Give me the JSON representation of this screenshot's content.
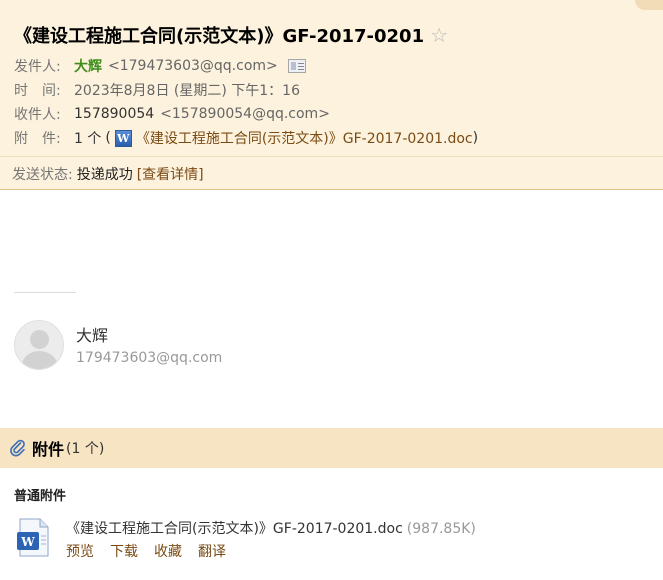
{
  "email": {
    "subject": "《建设工程施工合同(示范文本)》GF-2017-0201",
    "star_icon": "☆",
    "from": {
      "label": "发件人:",
      "name": "大辉",
      "address": "<179473603@qq.com>"
    },
    "time": {
      "label": "时　间:",
      "value": "2023年8月8日 (星期二) 下午1：16"
    },
    "to": {
      "label": "收件人:",
      "name": "157890054",
      "address": "<157890054@qq.com>"
    },
    "attachment_line": {
      "label": "附　件:",
      "count": "1 个",
      "open_paren": "(",
      "icon_letter": "W",
      "file": "《建设工程施工合同(示范文本)》GF-2017-0201.doc",
      "close_paren": ")"
    },
    "status": {
      "label": "发送状态:",
      "value": "投递成功",
      "link": "[查看详情]"
    }
  },
  "signature": {
    "name": "大辉",
    "email": "179473603@qq.com"
  },
  "attachments": {
    "title": "附件",
    "count": "(1 个)",
    "group": "普通附件",
    "items": [
      {
        "filename": "《建设工程施工合同(示范文本)》GF-2017-0201.doc",
        "size": "(987.85K)",
        "actions": [
          "预览",
          "下载",
          "收藏",
          "翻译"
        ]
      }
    ]
  },
  "colors": {
    "header_bg": "#fdf2dd",
    "attachment_bar_bg": "#f6e4c3",
    "link": "#7a4b14",
    "sender": "#3e8d1b"
  }
}
